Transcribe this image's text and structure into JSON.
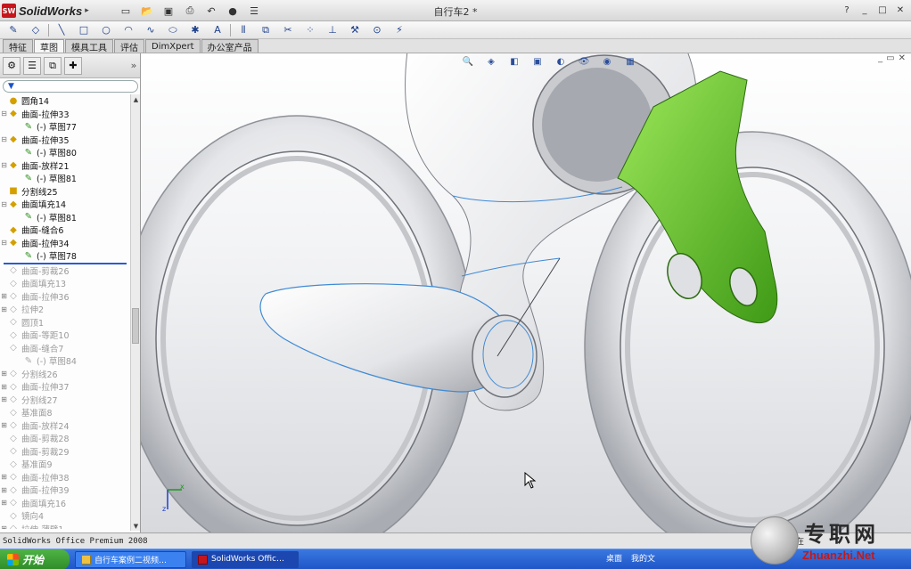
{
  "app": {
    "name": "SolidWorks",
    "doc_title": "自行车2 *"
  },
  "quick_access": [
    "new-icon",
    "open-icon",
    "save-icon",
    "print-icon",
    "undo-icon",
    "rebuild-icon",
    "options-icon"
  ],
  "window_controls": {
    "help": "?",
    "restore": "□",
    "close": "✕"
  },
  "command_tabs": [
    "特征",
    "草图",
    "模具工具",
    "评估",
    "DimXpert",
    "办公室产品"
  ],
  "active_tab": "草图",
  "tree_items": [
    {
      "label": "圆角14",
      "level": 0,
      "toggle": "",
      "icon": "●",
      "tone": "y",
      "state": "active"
    },
    {
      "label": "曲面-拉伸33",
      "level": 0,
      "toggle": "⊟",
      "icon": "◆",
      "tone": "y",
      "state": "active"
    },
    {
      "label": "(-) 草图77",
      "level": 1,
      "toggle": "",
      "icon": "✎",
      "tone": "g",
      "state": "active"
    },
    {
      "label": "曲面-拉伸35",
      "level": 0,
      "toggle": "⊟",
      "icon": "◆",
      "tone": "y",
      "state": "active"
    },
    {
      "label": "(-) 草图80",
      "level": 1,
      "toggle": "",
      "icon": "✎",
      "tone": "g",
      "state": "active"
    },
    {
      "label": "曲面-放样21",
      "level": 0,
      "toggle": "⊟",
      "icon": "◆",
      "tone": "y",
      "state": "active"
    },
    {
      "label": "(-) 草图81",
      "level": 1,
      "toggle": "",
      "icon": "✎",
      "tone": "g",
      "state": "active"
    },
    {
      "label": "分割线25",
      "level": 0,
      "toggle": "",
      "icon": "■",
      "tone": "y",
      "state": "active"
    },
    {
      "label": "曲面填充14",
      "level": 0,
      "toggle": "⊟",
      "icon": "◆",
      "tone": "y",
      "state": "active"
    },
    {
      "label": "(-) 草图81",
      "level": 1,
      "toggle": "",
      "icon": "✎",
      "tone": "g",
      "state": "active"
    },
    {
      "label": "曲面-缝合6",
      "level": 0,
      "toggle": "",
      "icon": "◆",
      "tone": "y",
      "state": "active"
    },
    {
      "label": "曲面-拉伸34",
      "level": 0,
      "toggle": "⊟",
      "icon": "◆",
      "tone": "y",
      "state": "active"
    },
    {
      "label": "(-) 草图78",
      "level": 1,
      "toggle": "",
      "icon": "✎",
      "tone": "g",
      "state": "active"
    },
    {
      "label": "曲面-剪裁26",
      "level": 0,
      "toggle": "",
      "icon": "◇",
      "tone": "gr",
      "state": "greyed"
    },
    {
      "label": "曲面填充13",
      "level": 0,
      "toggle": "",
      "icon": "◇",
      "tone": "gr",
      "state": "greyed"
    },
    {
      "label": "曲面-拉伸36",
      "level": 0,
      "toggle": "⊞",
      "icon": "◇",
      "tone": "gr",
      "state": "greyed"
    },
    {
      "label": "拉伸2",
      "level": 0,
      "toggle": "⊞",
      "icon": "◇",
      "tone": "gr",
      "state": "greyed"
    },
    {
      "label": "圆顶1",
      "level": 0,
      "toggle": "",
      "icon": "◇",
      "tone": "gr",
      "state": "greyed"
    },
    {
      "label": "曲面-等距10",
      "level": 0,
      "toggle": "",
      "icon": "◇",
      "tone": "gr",
      "state": "greyed"
    },
    {
      "label": "曲面-缝合7",
      "level": 0,
      "toggle": "",
      "icon": "◇",
      "tone": "gr",
      "state": "greyed"
    },
    {
      "label": "(-) 草图84",
      "level": 1,
      "toggle": "",
      "icon": "✎",
      "tone": "gr",
      "state": "greyed"
    },
    {
      "label": "分割线26",
      "level": 0,
      "toggle": "⊞",
      "icon": "◇",
      "tone": "gr",
      "state": "greyed"
    },
    {
      "label": "曲面-拉伸37",
      "level": 0,
      "toggle": "⊞",
      "icon": "◇",
      "tone": "gr",
      "state": "greyed"
    },
    {
      "label": "分割线27",
      "level": 0,
      "toggle": "⊞",
      "icon": "◇",
      "tone": "gr",
      "state": "greyed"
    },
    {
      "label": "基准面8",
      "level": 0,
      "toggle": "",
      "icon": "◇",
      "tone": "gr",
      "state": "greyed"
    },
    {
      "label": "曲面-放样24",
      "level": 0,
      "toggle": "⊞",
      "icon": "◇",
      "tone": "gr",
      "state": "greyed"
    },
    {
      "label": "曲面-剪裁28",
      "level": 0,
      "toggle": "",
      "icon": "◇",
      "tone": "gr",
      "state": "greyed"
    },
    {
      "label": "曲面-剪裁29",
      "level": 0,
      "toggle": "",
      "icon": "◇",
      "tone": "gr",
      "state": "greyed"
    },
    {
      "label": "基准面9",
      "level": 0,
      "toggle": "",
      "icon": "◇",
      "tone": "gr",
      "state": "greyed"
    },
    {
      "label": "曲面-拉伸38",
      "level": 0,
      "toggle": "⊞",
      "icon": "◇",
      "tone": "gr",
      "state": "greyed"
    },
    {
      "label": "曲面-拉伸39",
      "level": 0,
      "toggle": "⊞",
      "icon": "◇",
      "tone": "gr",
      "state": "greyed"
    },
    {
      "label": "曲面填充16",
      "level": 0,
      "toggle": "⊞",
      "icon": "◇",
      "tone": "gr",
      "state": "greyed"
    },
    {
      "label": "镜向4",
      "level": 0,
      "toggle": "",
      "icon": "◇",
      "tone": "gr",
      "state": "greyed"
    },
    {
      "label": "拉伸-薄壁1",
      "level": 0,
      "toggle": "⊞",
      "icon": "◇",
      "tone": "gr",
      "state": "greyed"
    }
  ],
  "status_bar": {
    "left": "SolidWorks Office Premium 2008",
    "right": "在"
  },
  "taskbar": {
    "start": "开始",
    "tasks": [
      "自行车案例二视频…",
      "SolidWorks Offic…"
    ],
    "desktop": "桌面",
    "my_docs": "我的文"
  },
  "watermark": {
    "chars": "专职网",
    "url": "Zhuanzhi.Net"
  },
  "colors": {
    "accent_green": "#6fce2c",
    "title_red": "#c4161c",
    "taskbar_blue": "#2a62d8"
  }
}
